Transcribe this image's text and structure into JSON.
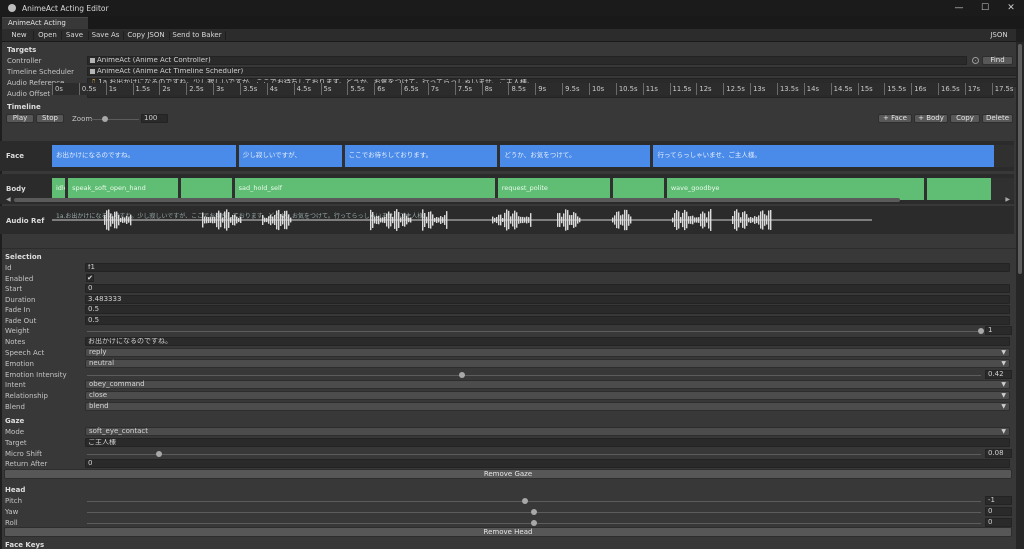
{
  "window": {
    "title": "AnimeAct Acting Editor",
    "tab": "AnimeAct Acting Editor",
    "controls": {
      "minimize": "—",
      "maximize": "☐",
      "close": "✕"
    }
  },
  "toolbar": {
    "new": "New",
    "open": "Open",
    "save": "Save",
    "save_as": "Save As",
    "copy_json": "Copy JSON",
    "send_to_baker": "Send to Baker",
    "json": "JSON"
  },
  "targets": {
    "heading": "Targets",
    "controller_label": "Controller",
    "controller_value": "AnimeAct (Anime Act Controller)",
    "timeline_label": "Timeline Scheduler",
    "timeline_value": "AnimeAct (Anime Act Timeline Scheduler)",
    "audio_label": "Audio Reference",
    "audio_value": "1a.お出かけになるのですね。少し寂しいですが、ここでお待ちしております。どうか、お気をつけて。行ってらっしゃいませ、ご主人様。",
    "offset_label": "Audio Offset",
    "offset_value": "0",
    "find": "Find"
  },
  "timeline": {
    "heading": "Timeline",
    "play": "Play",
    "stop": "Stop",
    "zoom_label": "Zoom",
    "zoom_value": "100",
    "zoom_fraction": 0.25,
    "add_face": "+ Face",
    "add_body": "+ Body",
    "copy": "Copy",
    "delete": "Delete",
    "ticks": [
      "0s",
      "0.5s",
      "1s",
      "1.5s",
      "2s",
      "2.5s",
      "3s",
      "3.5s",
      "4s",
      "4.5s",
      "5s",
      "5.5s",
      "6s",
      "6.5s",
      "7s",
      "7.5s",
      "8s",
      "8.5s",
      "9s",
      "9.5s",
      "10s",
      "10.5s",
      "11s",
      "11.5s",
      "12s",
      "12.5s",
      "13s",
      "13.5s",
      "14s",
      "14.5s",
      "15s",
      "15.5s",
      "16s",
      "16.5s",
      "17s",
      "17.5s"
    ],
    "tracks": {
      "face": "Face",
      "body": "Body",
      "audio": "Audio Ref"
    },
    "face_clips": [
      {
        "label": "お出かけになるのですね。",
        "start": 0.0,
        "end": 3.48
      },
      {
        "label": "少し寂しいですが、",
        "start": 3.48,
        "end": 5.45
      },
      {
        "label": "ここでお待ちしております。",
        "start": 5.45,
        "end": 8.35
      },
      {
        "label": "どうか、お気をつけて。",
        "start": 8.35,
        "end": 11.2
      },
      {
        "label": "行ってらっしゃいませ、ご主人様。",
        "start": 11.2,
        "end": 17.6
      }
    ],
    "body_clips": [
      {
        "label": "idle",
        "start": 0.0,
        "end": 0.3
      },
      {
        "label": "speak_soft_open_hand",
        "start": 0.3,
        "end": 2.4
      },
      {
        "label": "",
        "start": 2.4,
        "end": 3.4
      },
      {
        "label": "sad_hold_self",
        "start": 3.4,
        "end": 8.3
      },
      {
        "label": "request_polite",
        "start": 8.3,
        "end": 10.45
      },
      {
        "label": "",
        "start": 10.45,
        "end": 11.45
      },
      {
        "label": "wave_goodbye",
        "start": 11.45,
        "end": 16.3
      },
      {
        "label": "",
        "start": 16.3,
        "end": 17.55
      }
    ],
    "audio_text": "1a.お出かけになるのですね。少し寂しいですが、ここでお待ちしております。どうか、お気をつけて。行ってらっしゃいませ、ご主人様。"
  },
  "selection": {
    "heading": "Selection",
    "id_label": "Id",
    "id_value": "f1",
    "enabled_label": "Enabled",
    "enabled_value": "✔",
    "start_label": "Start",
    "start_value": "0",
    "duration_label": "Duration",
    "duration_value": "3.483333",
    "fade_in_label": "Fade In",
    "fade_in_value": "0.5",
    "fade_out_label": "Fade Out",
    "fade_out_value": "0.5",
    "weight_label": "Weight",
    "weight_value": "1",
    "weight_fraction": 1.0,
    "notes_label": "Notes",
    "notes_value": "お出かけになるのですね。",
    "speech_act_label": "Speech Act",
    "speech_act_value": "reply",
    "emotion_label": "Emotion",
    "emotion_value": "neutral",
    "emotion_intensity_label": "Emotion Intensity",
    "emotion_intensity_value": "0.42",
    "emotion_intensity_fraction": 0.42,
    "intent_label": "Intent",
    "intent_value": "obey_command",
    "relationship_label": "Relationship",
    "relationship_value": "close",
    "blend_label": "Blend",
    "blend_value": "blend"
  },
  "gaze": {
    "heading": "Gaze",
    "mode_label": "Mode",
    "mode_value": "soft_eye_contact",
    "target_label": "Target",
    "target_value": "ご主人様",
    "micro_shift_label": "Micro Shift",
    "micro_shift_value": "0.08",
    "micro_shift_fraction": 0.08,
    "return_after_label": "Return After",
    "return_after_value": "0",
    "remove": "Remove Gaze"
  },
  "head": {
    "heading": "Head",
    "pitch_label": "Pitch",
    "pitch_value": "-1",
    "pitch_fraction": 0.49,
    "yaw_label": "Yaw",
    "yaw_value": "0",
    "yaw_fraction": 0.5,
    "roll_label": "Roll",
    "roll_value": "0",
    "roll_fraction": 0.5,
    "remove": "Remove Head"
  },
  "next_section": "Face Keys",
  "colors": {
    "face_clip": "#4a8bea",
    "body_clip": "#5fbe73",
    "panel": "#383838"
  }
}
